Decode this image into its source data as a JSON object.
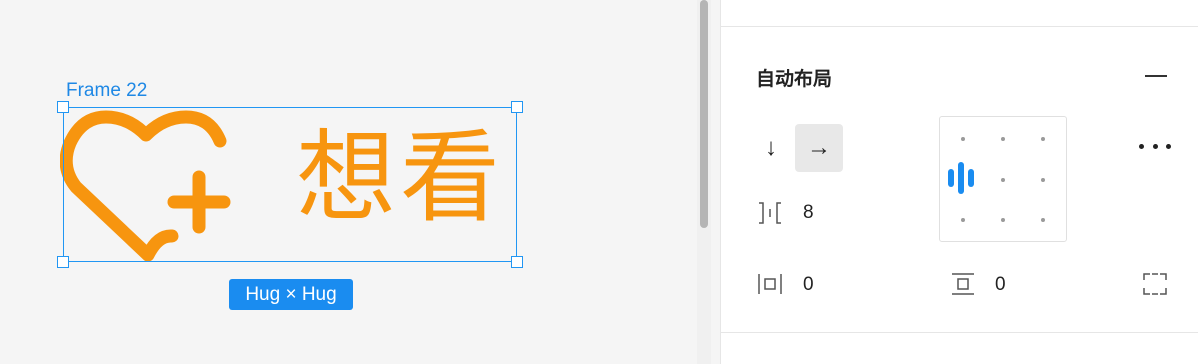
{
  "canvas": {
    "frame_label": "Frame 22",
    "frame_text": "想看",
    "size_badge": "Hug × Hug",
    "accent_color": "#f7950f",
    "selection_color": "#2196f3"
  },
  "panel": {
    "section_title": "自动布局",
    "direction": {
      "vertical_icon": "arrow-down-icon",
      "horizontal_icon": "arrow-right-icon",
      "selected": "horizontal"
    },
    "spacing_between": "8",
    "padding_horizontal": "0",
    "padding_vertical": "0",
    "alignment": "left-center"
  },
  "icons": [
    "heart-plus-icon",
    "remove-icon",
    "more-icon",
    "spacing-icon",
    "horizontal-padding-icon",
    "vertical-padding-icon",
    "independent-padding-icon"
  ]
}
